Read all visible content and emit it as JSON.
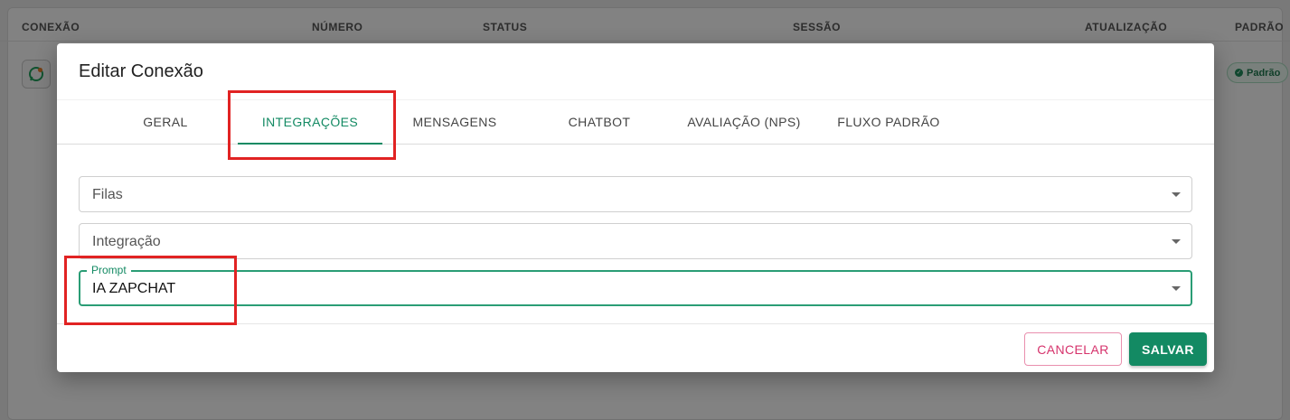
{
  "background_table": {
    "columns": [
      "CONEXÃO",
      "NÚMERO",
      "STATUS",
      "SESSÃO",
      "ATUALIZAÇÃO",
      "PADRÃO"
    ],
    "row_icon": "whatsapp-icon",
    "default_badge": "Padrão"
  },
  "dialog": {
    "title": "Editar Conexão",
    "tabs": [
      {
        "label": "GERAL",
        "active": false
      },
      {
        "label": "INTEGRAÇÕES",
        "active": true
      },
      {
        "label": "MENSAGENS",
        "active": false
      },
      {
        "label": "CHATBOT",
        "active": false
      },
      {
        "label": "AVALIAÇÃO (NPS)",
        "active": false
      },
      {
        "label": "FLUXO PADRÃO",
        "active": false
      }
    ],
    "fields": {
      "filas": {
        "placeholder": "Filas"
      },
      "integracao": {
        "placeholder": "Integração"
      },
      "prompt": {
        "label": "Prompt",
        "value": "IA ZAPCHAT"
      }
    },
    "buttons": {
      "cancel": "CANCELAR",
      "save": "SALVAR"
    }
  },
  "colors": {
    "accent": "#138a63",
    "cancel": "#d6336c",
    "highlight": "#e12323"
  }
}
